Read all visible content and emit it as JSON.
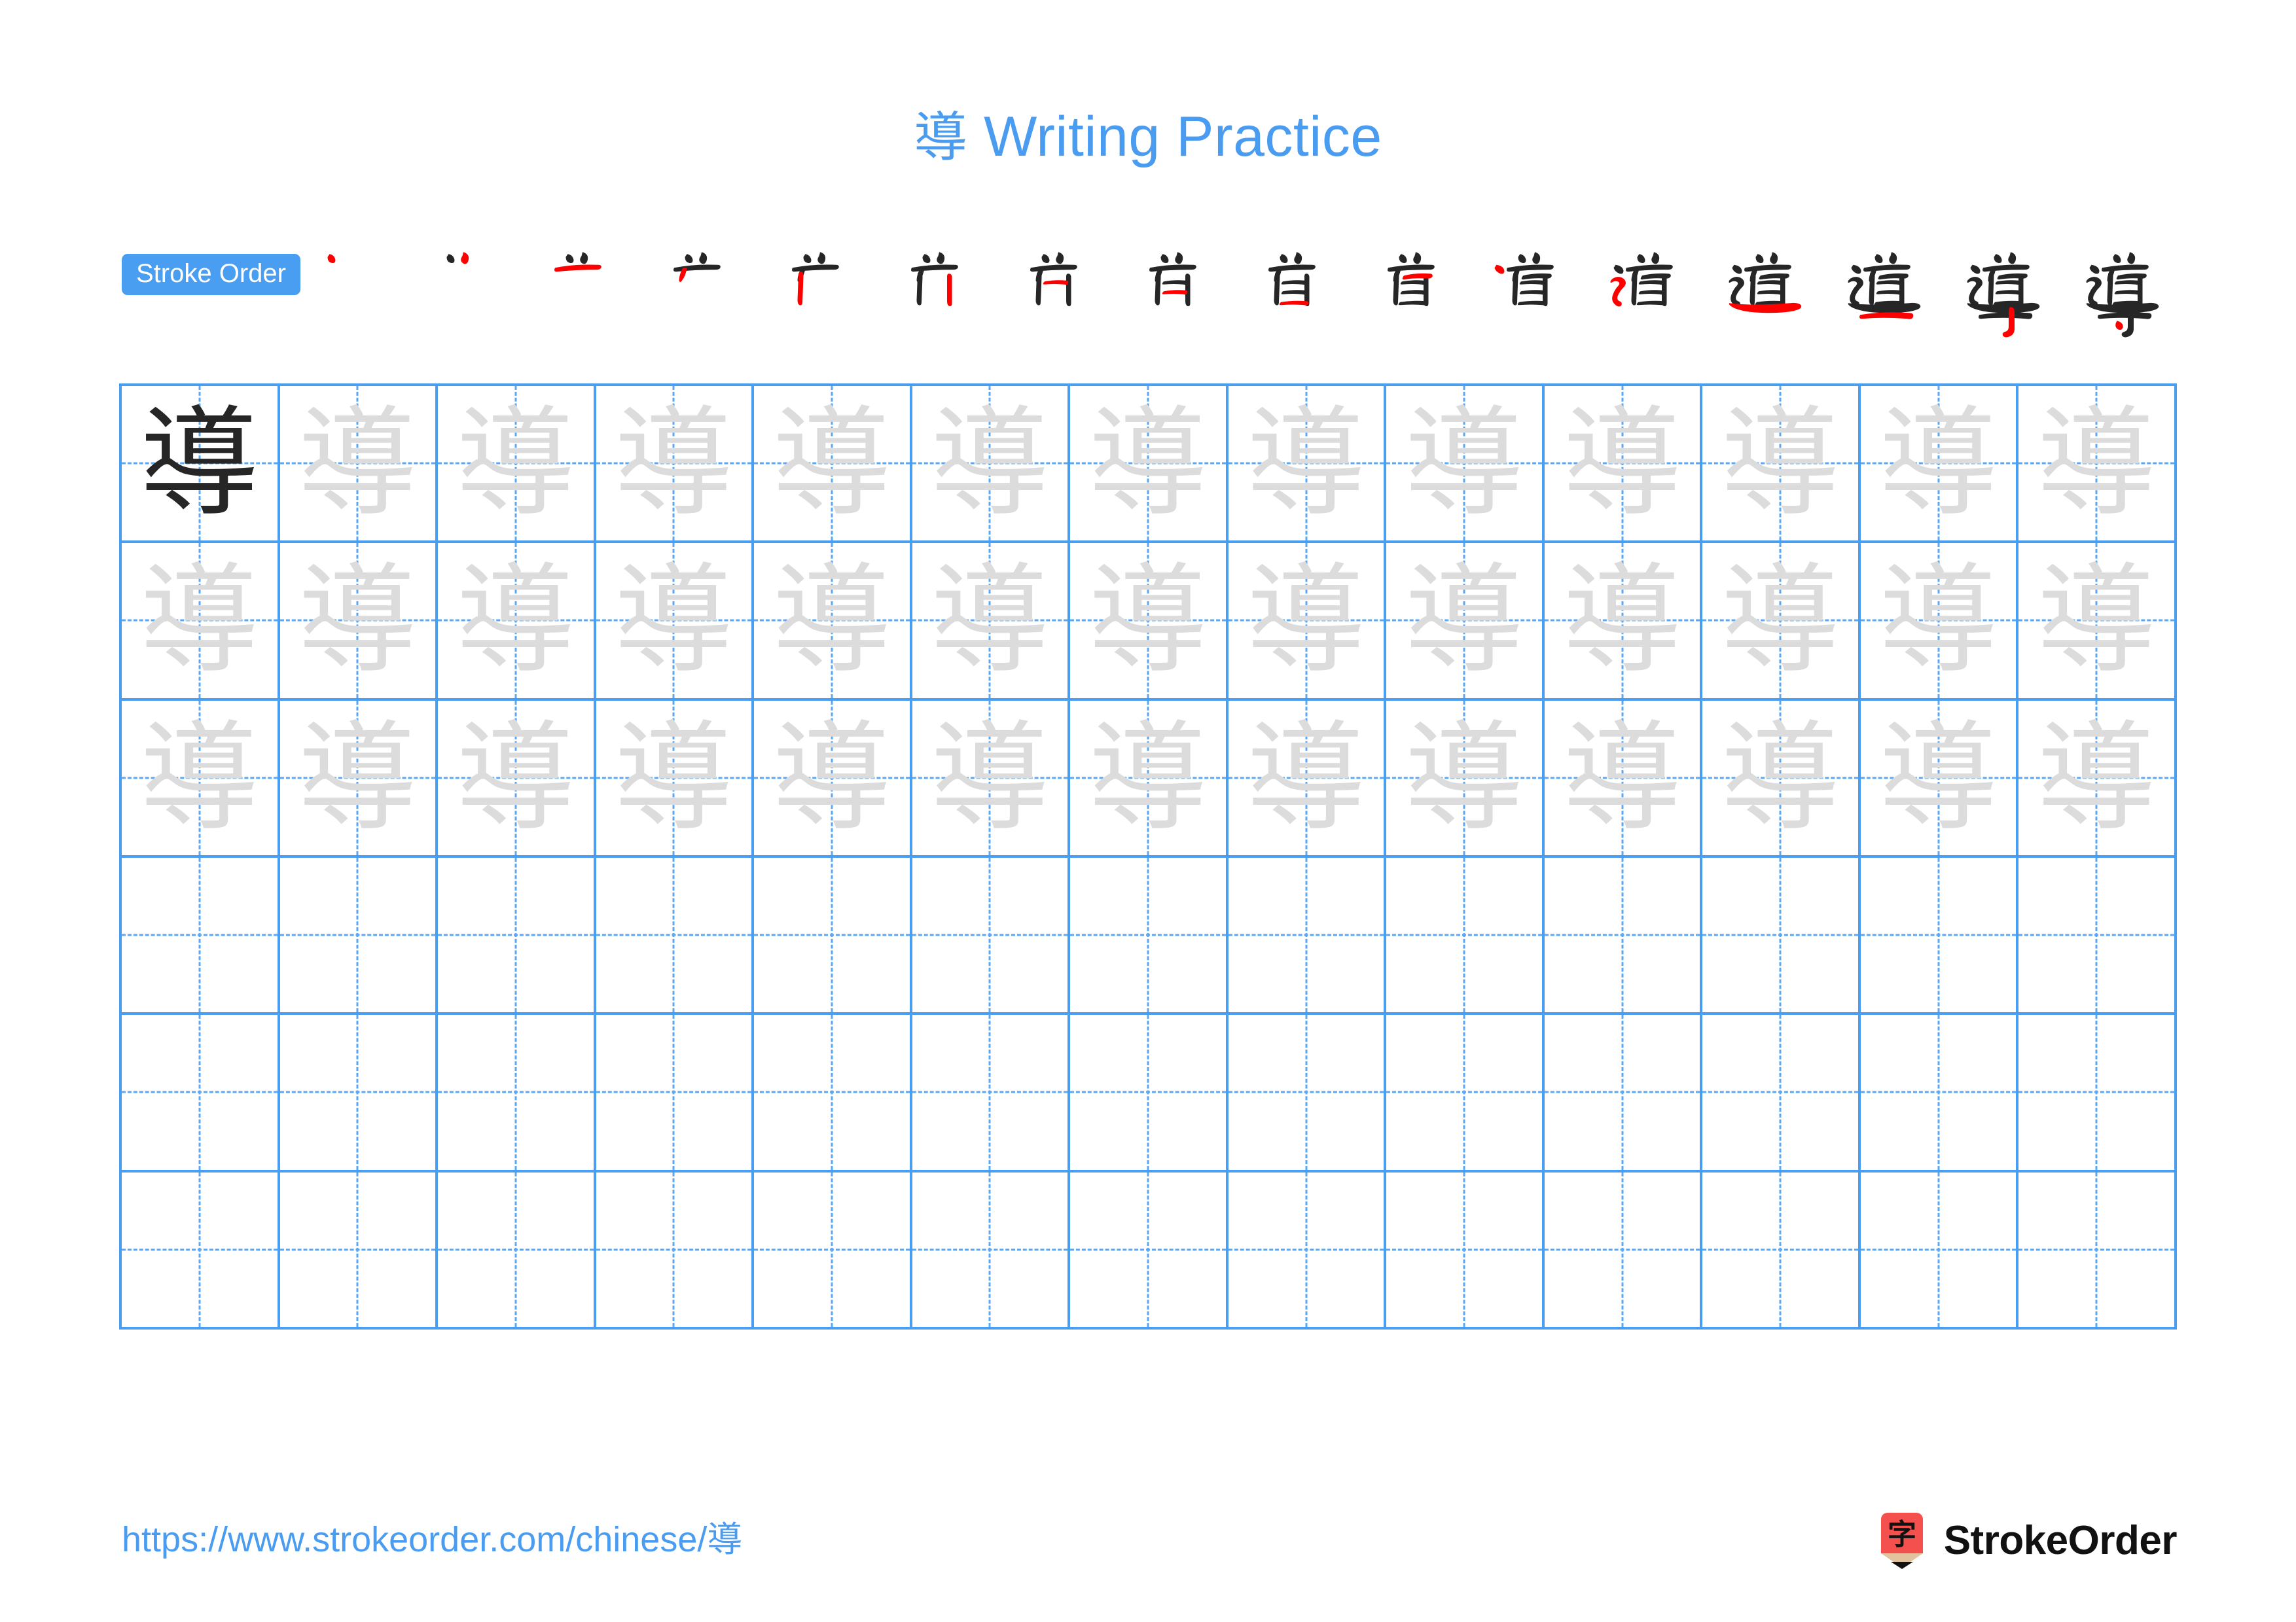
{
  "character": "導",
  "title": {
    "character": "導",
    "text": "Writing Practice",
    "color": "#4a9cf0"
  },
  "stroke_order": {
    "badge_label": "Stroke Order",
    "badge_bg": "#4a9ef2",
    "badge_text_color": "#ffffff",
    "total_strokes": 16,
    "new_stroke_color": "#ff0000",
    "prior_stroke_color": "#262626",
    "steps": [
      {
        "index": 1,
        "partial": "丶"
      },
      {
        "index": 2,
        "partial": "丷"
      },
      {
        "index": 3,
        "partial": "䒑"
      },
      {
        "index": 4,
        "partial": "丷丿"
      },
      {
        "index": 5,
        "partial": "产"
      },
      {
        "index": 6,
        "partial": "𠂆"
      },
      {
        "index": 7,
        "partial": "首"
      },
      {
        "index": 8,
        "partial": "首"
      },
      {
        "index": 9,
        "partial": "首"
      },
      {
        "index": 10,
        "partial": "首"
      },
      {
        "index": 11,
        "partial": "辶首"
      },
      {
        "index": 12,
        "partial": "道"
      },
      {
        "index": 13,
        "partial": "道"
      },
      {
        "index": 14,
        "partial": "道"
      },
      {
        "index": 15,
        "partial": "導"
      },
      {
        "index": 16,
        "partial": "導"
      }
    ]
  },
  "grid": {
    "columns": 13,
    "rows": 6,
    "border_color": "#4a9ef2",
    "guide_color": "#5aa8f5",
    "solid_char_color": "#262626",
    "trace_char_color": "#dcdcdc",
    "row_modes": [
      "first-solid-rest-trace",
      "trace",
      "trace",
      "empty",
      "empty",
      "empty"
    ]
  },
  "footer": {
    "url": "https://www.strokeorder.com/chinese/導",
    "url_color": "#4a9cf0",
    "brand_name": "StrokeOrder",
    "logo_character": "字",
    "logo_body_color": "#f4514e",
    "logo_wood_color": "#e3c39d",
    "logo_tip_color": "#111111"
  }
}
